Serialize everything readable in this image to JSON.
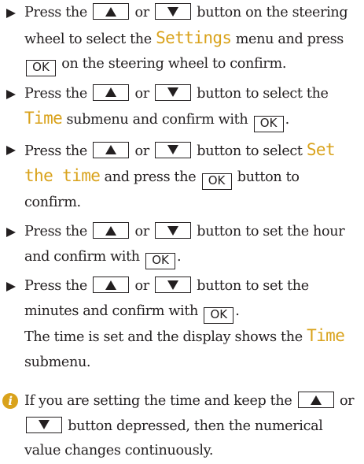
{
  "steps": [
    {
      "t1": "Press the",
      "t2": "or",
      "t3": "button on the steering wheel to select the",
      "display": "Settings",
      "t4": "menu and press",
      "ok": "OK",
      "t5": "on the steering wheel to confirm."
    },
    {
      "t1": "Press the",
      "t2": "or",
      "t3": "button to select the",
      "display": "Time",
      "t4": "submenu and confirm with",
      "ok": "OK",
      "t5": "."
    },
    {
      "t1": "Press the",
      "t2": "or",
      "t3": "button to select",
      "display": "Set the time",
      "t4": "and press the",
      "ok": "OK",
      "t5": "button to confirm."
    },
    {
      "t1": "Press the",
      "t2": "or",
      "t3": "button to set the hour and confirm with",
      "ok": "OK",
      "t4": "."
    },
    {
      "t1": "Press the",
      "t2": "or",
      "t3": "button to set the minutes and confirm with",
      "ok": "OK",
      "t4": ".",
      "result": "The time is set and the display shows the",
      "display": "Time",
      "result_end": "submenu."
    }
  ],
  "note": {
    "icon": "info-icon",
    "t1": "If you are setting the time and keep the",
    "t2": "or",
    "t3": "button depressed, then the numerical value changes continuously."
  },
  "colors": {
    "display_text": "#d9a21b",
    "text": "#231f20"
  },
  "icons": {
    "bullet": "triangle-right-icon",
    "up_key": "up-arrow-key-icon",
    "down_key": "down-arrow-key-icon",
    "info": "info-icon"
  }
}
